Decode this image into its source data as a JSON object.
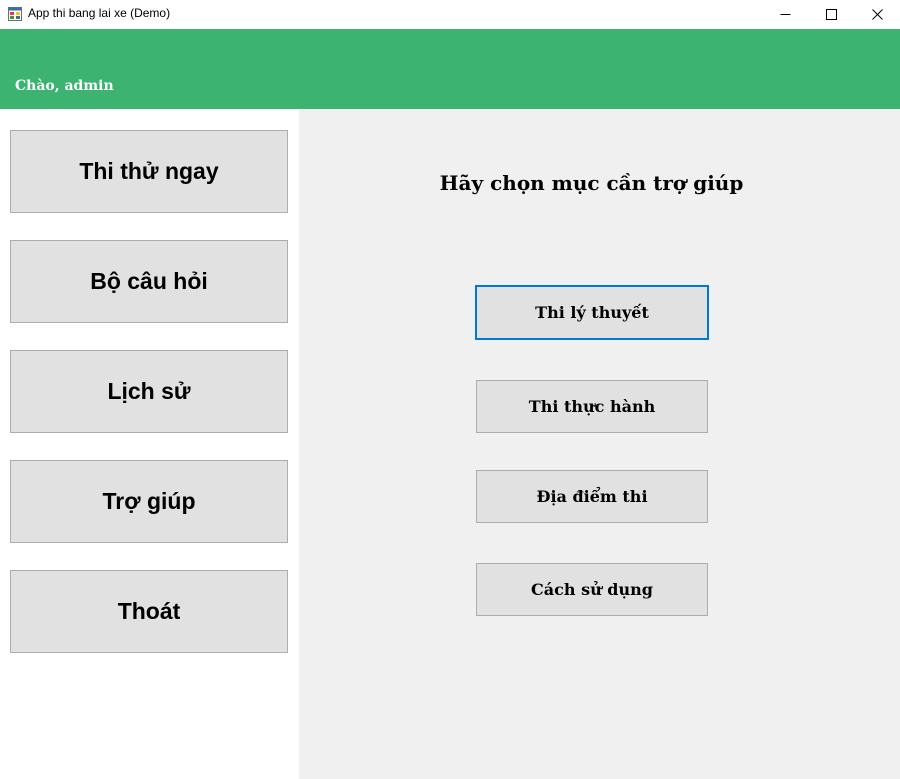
{
  "window": {
    "title": "App thi bang lai xe (Demo)"
  },
  "header": {
    "greeting": "Chào, admin",
    "color": "#3cb371"
  },
  "sidebar": {
    "items": [
      {
        "label": "Thi thử ngay"
      },
      {
        "label": "Bộ câu hỏi"
      },
      {
        "label": "Lịch sử"
      },
      {
        "label": "Trợ giúp"
      },
      {
        "label": "Thoát"
      }
    ]
  },
  "main": {
    "title": "Hãy chọn mục cần trợ giúp",
    "buttons": [
      {
        "label": "Thi lý thuyết",
        "focused": true
      },
      {
        "label": "Thi thực hành",
        "focused": false
      },
      {
        "label": "Địa điểm thi",
        "focused": false
      },
      {
        "label": "Cách sử dụng",
        "focused": false
      }
    ]
  },
  "icons": {
    "app": "app-icon",
    "minimize": "minimize-icon",
    "maximize": "maximize-icon",
    "close": "close-icon"
  },
  "colors": {
    "focus_border": "#0078d7",
    "button_bg": "#e1e1e1",
    "content_bg": "#f0f0f0"
  }
}
